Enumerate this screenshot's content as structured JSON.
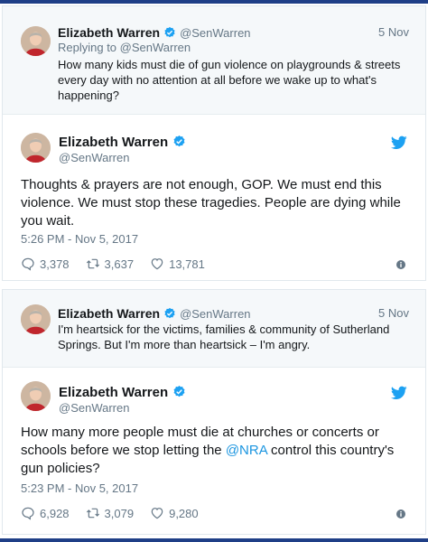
{
  "tweets": [
    {
      "quoted": {
        "name": "Elizabeth Warren",
        "handle": "@SenWarren",
        "date": "5 Nov",
        "reply_to": "Replying to @SenWarren",
        "text": "How many kids must die of gun violence on playgrounds & streets every day with no attention at all before we wake up to what's happening?"
      },
      "name": "Elizabeth Warren",
      "handle": "@SenWarren",
      "text": "Thoughts & prayers are not enough, GOP. We must end this violence. We must stop these tragedies. People are dying while you wait.",
      "time": "5:26 PM - Nov 5, 2017",
      "replies": "3,378",
      "retweets": "3,637",
      "likes": "13,781"
    },
    {
      "quoted": {
        "name": "Elizabeth Warren",
        "handle": "@SenWarren",
        "date": "5 Nov",
        "text": "I'm heartsick for the victims, families & community of Sutherland Springs. But I'm more than heartsick – I'm angry."
      },
      "name": "Elizabeth Warren",
      "handle": "@SenWarren",
      "text_before": "How many more people must die at churches or concerts or schools before we stop letting the ",
      "mention": "@NRA",
      "text_after": " control this country's gun policies?",
      "time": "5:23 PM - Nov 5, 2017",
      "replies": "6,928",
      "retweets": "3,079",
      "likes": "9,280"
    }
  ],
  "colors": {
    "frame": "#1f3f87",
    "verified": "#1da1f2",
    "twitter_blue": "#1da1f2",
    "link": "#1b95e0",
    "muted": "#657786"
  },
  "icons": [
    "verified-badge-icon",
    "twitter-bird-icon",
    "reply-icon",
    "retweet-icon",
    "like-heart-icon",
    "info-icon"
  ]
}
